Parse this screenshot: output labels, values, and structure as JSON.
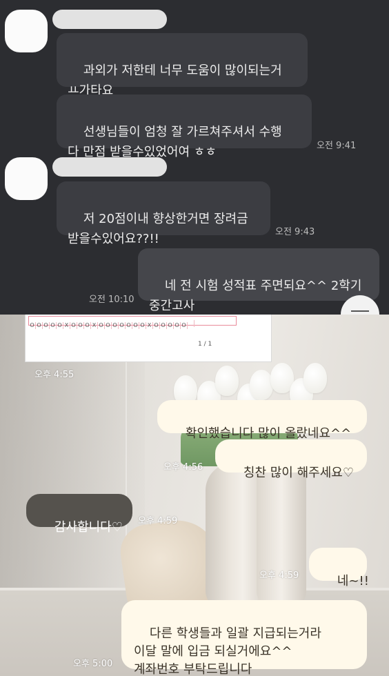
{
  "top_chat": {
    "messages": [
      {
        "text": "과외가 저한테 너무 도움이 많이되는거\nㅛ가타요",
        "time": ""
      },
      {
        "text": "선생님들이 엄청 잘 가르쳐주셔서 수행\n다 만점 받을수있었어여 ㅎㅎ",
        "time": "오전 9:41"
      },
      {
        "text": "저 20점이내 향상한거면 장려금\n받을수있어요??!!",
        "time": "오전 9:43"
      },
      {
        "text": "네 전 시험 성적표 주면되요^^ 2학기\n중간고사",
        "time": "오전 10:10"
      }
    ]
  },
  "bottom_chat": {
    "document": {
      "grid_marks": "OOO|OOXOOOXOOOOOOOXOOOOO",
      "page_indicator": "1 / 1",
      "time": "오후 4:55"
    },
    "messages": [
      {
        "text": "확인했습니다 많이 올랐네요^^",
        "time": ""
      },
      {
        "text": "칭찬 많이 해주세요♡",
        "time": "오후 4:56"
      },
      {
        "text": "감사합니다♡",
        "time": "오후 4:59"
      },
      {
        "text": "네~!!",
        "time": "오후 4:59"
      },
      {
        "text": "다른 학생들과 일괄 지급되는거라\n이달 말에 입금 되실거에요^^\n계좌번호 부탁드립니다",
        "time": "오후 5:00"
      }
    ]
  },
  "colors": {
    "top_background": "#2c2d31",
    "top_bubble": "#3c3d42",
    "bottom_my_bubble": "#fff9ea",
    "bottom_their_bubble": "#55524d"
  }
}
